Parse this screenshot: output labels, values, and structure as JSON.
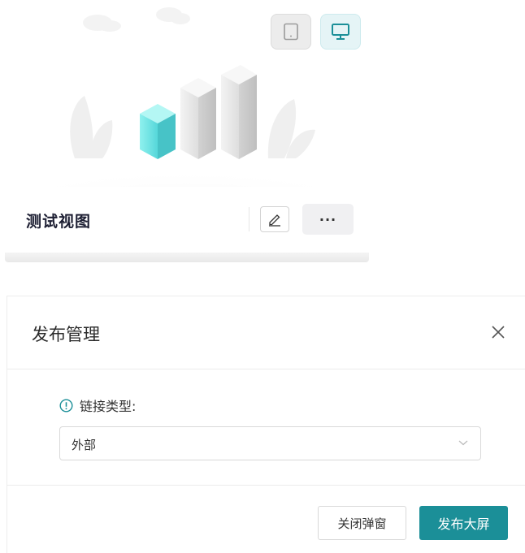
{
  "card": {
    "title": "测试视图",
    "view_modes": [
      {
        "icon": "tablet-icon",
        "active": false
      },
      {
        "icon": "desktop-icon",
        "active": true
      }
    ],
    "more_label": "···"
  },
  "dialog": {
    "title": "发布管理",
    "field_label": "链接类型:",
    "select_value": "外部",
    "cancel_label": "关闭弹窗",
    "confirm_label": "发布大屏"
  },
  "colors": {
    "accent": "#1b8f98",
    "accent_light": "#e5f4f6",
    "title_text": "#1d1f33"
  }
}
